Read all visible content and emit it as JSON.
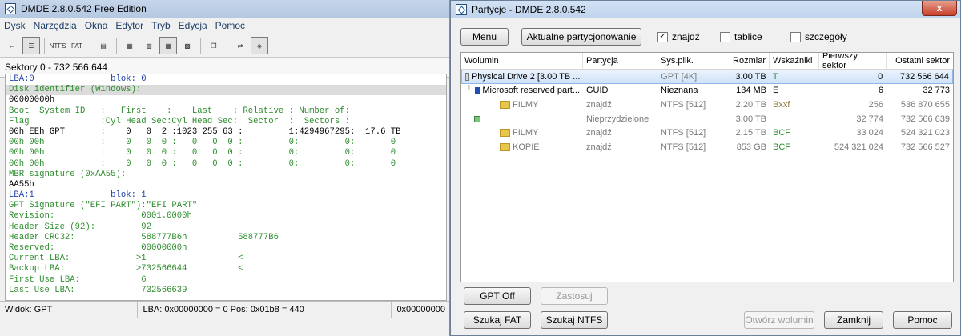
{
  "left": {
    "title": "DMDE 2.8.0.542 Free Edition",
    "menu": [
      "Dysk",
      "Narzędzia",
      "Okna",
      "Edytor",
      "Tryb",
      "Edycja",
      "Pomoc"
    ],
    "toolbar": {
      "ntfs": "NTFS",
      "fat": "FAT"
    },
    "sector_header": "Sektory 0 - 732 566 644",
    "hex_lines": [
      "LBA:0               blok: 0",
      "Disk identifier (Windows):",
      "00000000h",
      "Boot  System ID   :   First    :    Last    : Relative : Number of:",
      "Flag              :Cyl Head Sec:Cyl Head Sec:  Sector  :  Sectors :",
      "00h EEh GPT       :    0   0  2 :1023 255 63 :         1:4294967295:  17.6 TB",
      "00h 00h           :    0   0  0 :   0   0  0 :         0:         0:       0",
      "00h 00h           :    0   0  0 :   0   0  0 :         0:         0:       0",
      "00h 00h           :    0   0  0 :   0   0  0 :         0:         0:       0",
      "MBR signature (0xAA55):",
      "AA55h",
      "LBA:1               blok: 1",
      "GPT Signature (\"EFI PART\"):\"EFI PART\"",
      "Revision:                 0001.0000h",
      "Header Size (92):         92",
      "Header CRC32:             588777B6h          588777B6",
      "Reserved:                 00000000h",
      "Current LBA:             >1                  <",
      "Backup LBA:              >732566644          <",
      "First Use LBA:            6",
      "Last Use LBA:             732566639"
    ],
    "status": {
      "view": "Widok: GPT",
      "pos": "LBA: 0x00000000 = 0  Pos: 0x01b8 = 440",
      "extra": "0x00000000"
    }
  },
  "right": {
    "title": "Partycje - DMDE 2.8.0.542",
    "close": "x",
    "buttons": {
      "menu": "Menu",
      "current": "Aktualne partycjonowanie",
      "gpt_off": "GPT Off",
      "apply": "Zastosuj",
      "search_fat": "Szukaj FAT",
      "search_ntfs": "Szukaj NTFS",
      "open_volume": "Otwórz wolumin",
      "close": "Zamknij",
      "help": "Pomoc"
    },
    "checks": {
      "found": {
        "label": "znajdź",
        "checked": true
      },
      "tables": {
        "label": "tablice",
        "checked": false
      },
      "details": {
        "label": "szczegóły",
        "checked": false
      }
    },
    "columns": [
      "Wolumin",
      "Partycja",
      "Sys.plik.",
      "Rozmiar",
      "Wskaźniki",
      "Pierwszy sektor",
      "Ostatni sektor"
    ],
    "rows": [
      {
        "icon": "drive",
        "vol": "Physical Drive 2 [3.00 TB ...",
        "part": "",
        "fs": "GPT [4K]",
        "size": "3.00 TB",
        "flags": "T",
        "first": "0",
        "last": "732 566 644"
      },
      {
        "icon": "msr",
        "vol": "Microsoft reserved part...",
        "part": "GUID",
        "fs": "Nieznana",
        "size": "134 MB",
        "flags": "E",
        "first": "6",
        "last": "32 773"
      },
      {
        "icon": "folder",
        "vol": "FILMY",
        "part": "znajdź",
        "fs": "NTFS [512]",
        "size": "2.20 TB",
        "flags": "Bxxf",
        "first": "256",
        "last": "536 870 655"
      },
      {
        "icon": "free",
        "vol": "",
        "part": "Nieprzydzielone",
        "fs": "",
        "size": "3.00 TB",
        "flags": "",
        "first": "32 774",
        "last": "732 566 639"
      },
      {
        "icon": "folder",
        "vol": "FILMY",
        "part": "znajdź",
        "fs": "NTFS [512]",
        "size": "2.15 TB",
        "flags": "BCF",
        "first": "33 024",
        "last": "524 321 023"
      },
      {
        "icon": "folder",
        "vol": "KOPIE",
        "part": "znajdź",
        "fs": "NTFS [512]",
        "size": "853 GB",
        "flags": "BCF",
        "first": "524 321 024",
        "last": "732 566 527"
      }
    ]
  }
}
